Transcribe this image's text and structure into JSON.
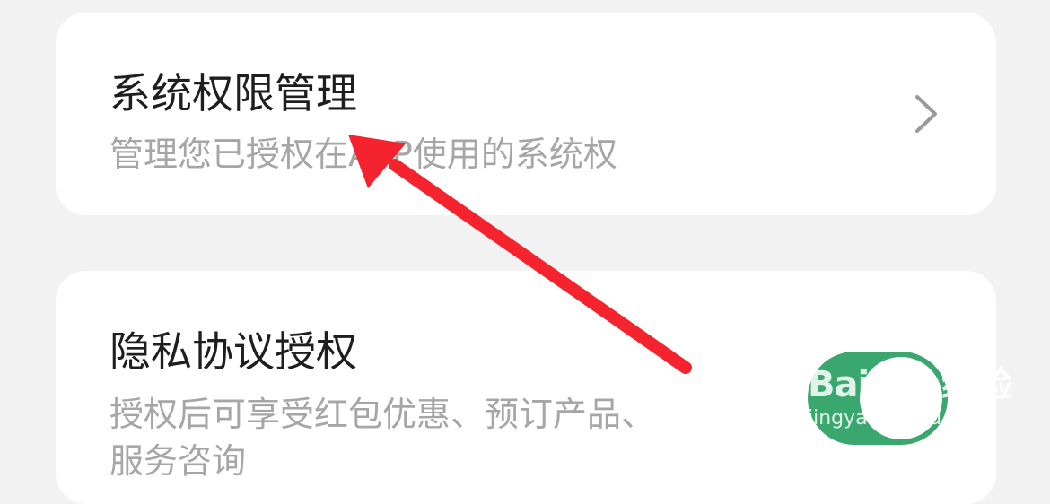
{
  "items": [
    {
      "title": "系统权限管理",
      "subtitle": "管理您已授权在APP使用的系统权",
      "control": "chevron-right"
    },
    {
      "title": "隐私协议授权",
      "subtitle": "授权后可享受红包优惠、预订产品、",
      "subtitle_2": "服务咨询",
      "control": "toggle",
      "toggle_on": true
    }
  ],
  "colors": {
    "background": "#f2f2f2",
    "card": "#ffffff",
    "title": "#1e1e1e",
    "subtitle": "#a6a6a6",
    "toggle_on": "#3aa86e",
    "annotation_arrow": "#f5232d"
  },
  "watermark": {
    "logo": "Bai du 经验",
    "url": "jingyan.baidu.com"
  }
}
